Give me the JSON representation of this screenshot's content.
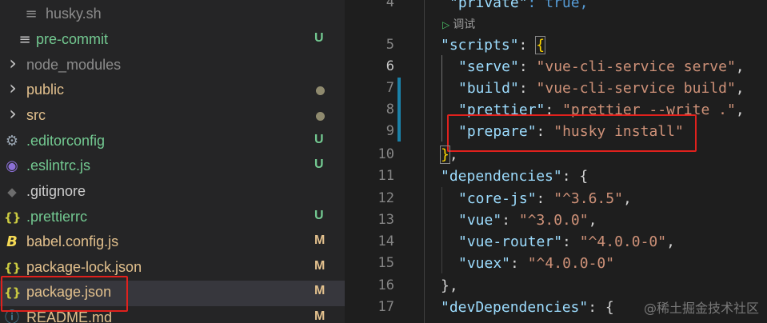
{
  "colors": {
    "untracked": "#73c991",
    "modified": "#e2c08d",
    "ignored_dot": "#8f8a6e",
    "highlight_box": "#e0211d",
    "json_key": "#9cdcfe",
    "json_string": "#ce9178"
  },
  "explorer": {
    "files": [
      {
        "name": "husky.sh",
        "icon": "lines-file-icon",
        "glyph": "≡",
        "status": ""
      },
      {
        "name": "pre-commit",
        "icon": "lines-file-icon",
        "glyph": "≡",
        "status": "U"
      },
      {
        "name": "node_modules",
        "icon": "chevron-right-icon",
        "glyph": "›",
        "status": ""
      },
      {
        "name": "public",
        "icon": "chevron-right-icon",
        "glyph": "›",
        "status": "dot"
      },
      {
        "name": "src",
        "icon": "chevron-right-icon",
        "glyph": "›",
        "status": "dot"
      },
      {
        "name": ".editorconfig",
        "icon": "gear-icon",
        "glyph": "⚙",
        "status": "U"
      },
      {
        "name": ".eslintrc.js",
        "icon": "eslint-icon",
        "glyph": "◉",
        "status": "U"
      },
      {
        "name": ".gitignore",
        "icon": "git-icon",
        "glyph": "◆",
        "status": ""
      },
      {
        "name": ".prettierrc",
        "icon": "json-braces-icon",
        "glyph": "{}",
        "status": "U"
      },
      {
        "name": "babel.config.js",
        "icon": "babel-icon",
        "glyph": "B",
        "status": "M"
      },
      {
        "name": "package-lock.json",
        "icon": "json-braces-icon",
        "glyph": "{}",
        "status": "M"
      },
      {
        "name": "package.json",
        "icon": "json-braces-icon",
        "glyph": "{}",
        "status": "M"
      },
      {
        "name": "README.md",
        "icon": "info-icon",
        "glyph": "ⓘ",
        "status": "M"
      }
    ]
  },
  "editor": {
    "codelens": "调试",
    "codelens_icon": "play-icon",
    "lines": [
      {
        "n": "4",
        "current": false,
        "k": "\"private\"",
        "rest": ": true,"
      },
      {
        "n": "5",
        "current": false,
        "k": "\"scripts\"",
        "rest": ": {"
      },
      {
        "n": "6",
        "current": true,
        "k": "\"serve\"",
        "rest": ": ",
        "v": "\"vue-cli-service serve\"",
        "tail": ","
      },
      {
        "n": "7",
        "current": false,
        "k": "\"build\"",
        "rest": ": ",
        "v": "\"vue-cli-service build\"",
        "tail": ","
      },
      {
        "n": "8",
        "current": false,
        "k": "\"prettier\"",
        "rest": ": ",
        "v": "\"prettier --write .\"",
        "tail": ","
      },
      {
        "n": "9",
        "current": false,
        "k": "\"prepare\"",
        "rest": ": ",
        "v": "\"husky install\"",
        "tail": ""
      },
      {
        "n": "10",
        "current": false,
        "k": "",
        "rest": "},"
      },
      {
        "n": "11",
        "current": false,
        "k": "\"dependencies\"",
        "rest": ": {"
      },
      {
        "n": "12",
        "current": false,
        "k": "\"core-js\"",
        "rest": ": ",
        "v": "\"^3.6.5\"",
        "tail": ","
      },
      {
        "n": "13",
        "current": false,
        "k": "\"vue\"",
        "rest": ": ",
        "v": "\"^3.0.0\"",
        "tail": ","
      },
      {
        "n": "14",
        "current": false,
        "k": "\"vue-router\"",
        "rest": ": ",
        "v": "\"^4.0.0-0\"",
        "tail": ","
      },
      {
        "n": "15",
        "current": false,
        "k": "\"vuex\"",
        "rest": ": ",
        "v": "\"^4.0.0-0\"",
        "tail": ""
      },
      {
        "n": "16",
        "current": false,
        "k": "",
        "rest": "},"
      },
      {
        "n": "17",
        "current": false,
        "k": "\"devDependencies\"",
        "rest": ": {"
      }
    ]
  },
  "watermark": "@稀土掘金技术社区"
}
